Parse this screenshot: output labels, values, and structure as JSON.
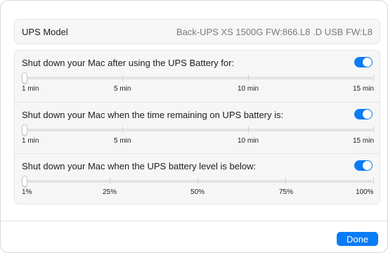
{
  "ups_model": {
    "label": "UPS Model",
    "value": "Back-UPS XS 1500G FW:866.L8 .D USB FW:L8"
  },
  "settings": [
    {
      "label": "Shut down your Mac after using the UPS Battery for:",
      "enabled": true,
      "slider_value_fraction": 0,
      "ticks": [
        {
          "label": "1 min",
          "fraction": 0.0
        },
        {
          "label": "5 min",
          "fraction": 0.286
        },
        {
          "label": "10 min",
          "fraction": 0.643
        },
        {
          "label": "15 min",
          "fraction": 1.0
        }
      ]
    },
    {
      "label": "Shut down your Mac when the time remaining on UPS battery is:",
      "enabled": true,
      "slider_value_fraction": 0,
      "ticks": [
        {
          "label": "1 min",
          "fraction": 0.0
        },
        {
          "label": "5 min",
          "fraction": 0.286
        },
        {
          "label": "10 min",
          "fraction": 0.643
        },
        {
          "label": "15 min",
          "fraction": 1.0
        }
      ]
    },
    {
      "label": "Shut down your Mac when the UPS battery level is below:",
      "enabled": true,
      "slider_value_fraction": 0,
      "ticks": [
        {
          "label": "1%",
          "fraction": 0.0
        },
        {
          "label": "25%",
          "fraction": 0.25
        },
        {
          "label": "50%",
          "fraction": 0.5
        },
        {
          "label": "75%",
          "fraction": 0.75
        },
        {
          "label": "100%",
          "fraction": 1.0
        }
      ]
    }
  ],
  "footer": {
    "done_label": "Done"
  },
  "colors": {
    "accent": "#0a7cf5"
  }
}
